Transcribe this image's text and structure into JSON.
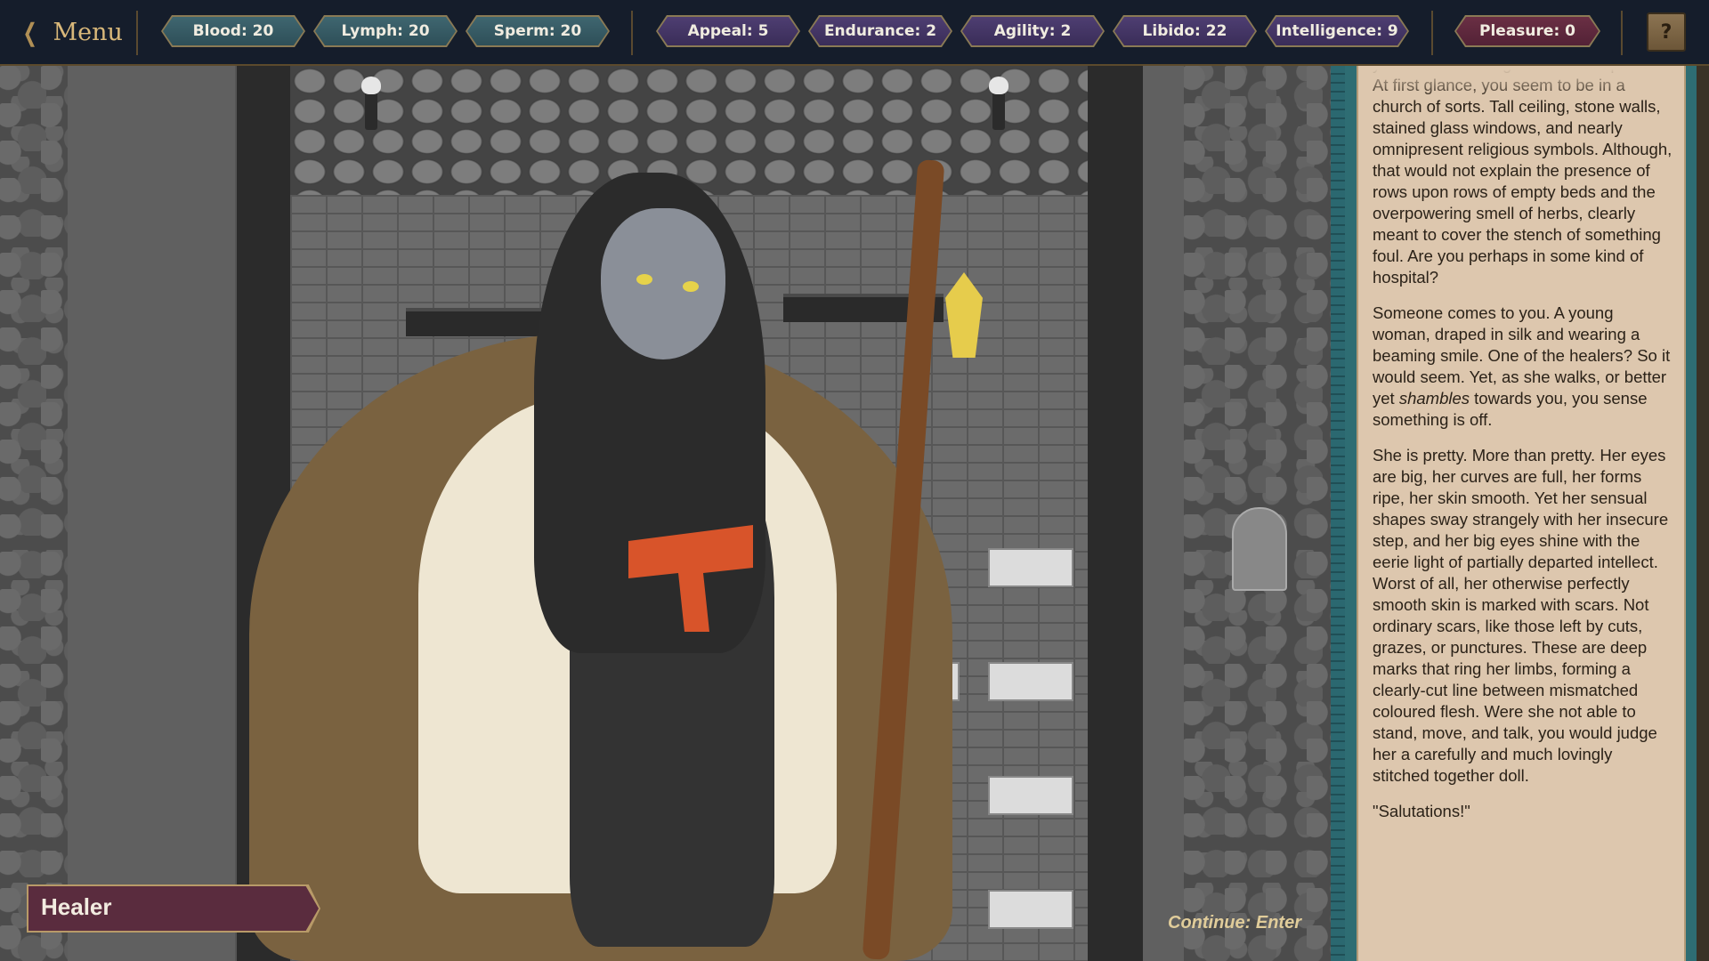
{
  "topbar": {
    "menu_label": "Menu",
    "fluids": [
      {
        "label": "Blood: 20"
      },
      {
        "label": "Lymph: 20"
      },
      {
        "label": "Sperm: 20"
      }
    ],
    "attributes": [
      {
        "label": "Appeal: 5"
      },
      {
        "label": "Endurance: 2"
      },
      {
        "label": "Agility: 2"
      },
      {
        "label": "Libido: 22"
      },
      {
        "label": "Intelligence: 9"
      }
    ],
    "pleasure": {
      "label": "Pleasure: 0"
    },
    "help_label": "?"
  },
  "scene": {
    "speaker_name": "Healer",
    "continue_hint": "Continue: Enter"
  },
  "story": {
    "p1_partial": "yourself in a strange and distant place. At first glance, you seem to be in a church of sorts. Tall ceiling, stone walls, stained glass windows, and nearly omnipresent religious symbols. Although, that would not explain the presence of rows upon rows of empty beds and the overpowering smell of herbs, clearly meant to cover the stench of something foul. Are you perhaps in some kind of hospital?",
    "p2_before": "Someone comes to you. A young woman, draped in silk and wearing a beaming smile. One of the healers? So it would seem. Yet, as she walks, or better yet ",
    "p2_em": "shambles",
    "p2_after": " towards you, you sense something is off.",
    "p3": "She is pretty. More than pretty. Her eyes are big, her curves are full, her forms ripe, her skin smooth. Yet her sensual shapes sway strangely with her insecure step, and her big eyes shine with the eerie light of partially departed intellect. Worst of all, her otherwise perfectly smooth skin is marked with scars. Not ordinary scars, like those left by cuts, grazes, or punctures. These are deep marks that ring her limbs, forming a clearly-cut line between mismatched coloured flesh. Were she not able to stand, move, and talk, you would judge her a carefully and much lovingly stitched together doll.",
    "p4": "\"Salutations!\""
  }
}
